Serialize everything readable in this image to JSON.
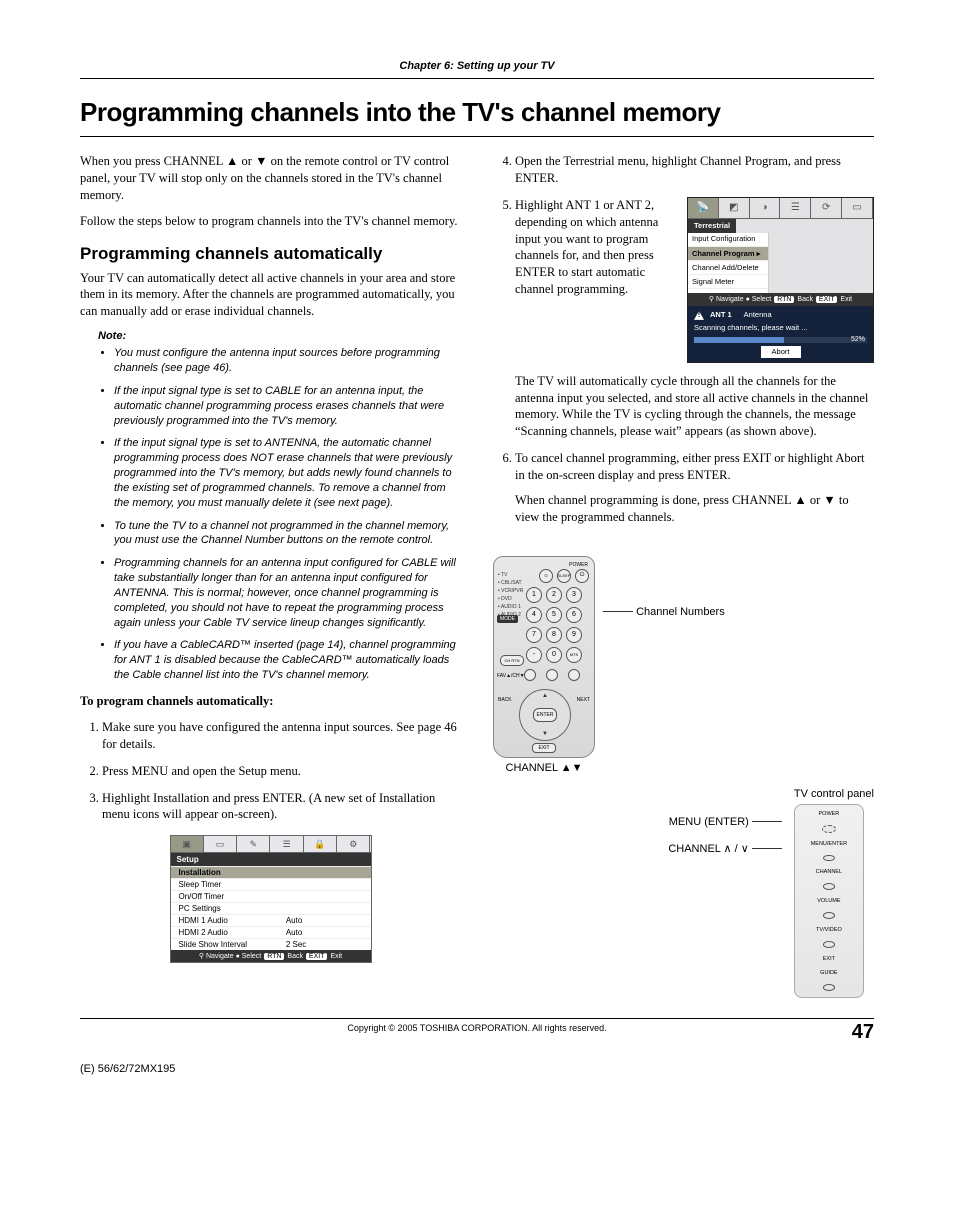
{
  "chapter_heading": "Chapter 6: Setting up your TV",
  "page_title": "Programming channels into the TV's channel memory",
  "intro_p1": "When you press CHANNEL ▲ or ▼ on the remote control or TV control panel, your TV will stop only on the channels stored in the TV's channel memory.",
  "intro_p2": "Follow the steps below to program channels into the TV's channel memory.",
  "section_heading": "Programming channels automatically",
  "section_p1": "Your TV can automatically detect all active channels in your area and store them in its memory. After the channels are programmed automatically, you can manually add or erase individual channels.",
  "note_title": "Note:",
  "notes": [
    "You must configure the antenna input sources before programming channels (see page 46).",
    "If the input signal type is set to CABLE for an antenna input, the automatic channel programming process erases channels that were previously programmed into the TV's memory.",
    "If the input signal type is set to ANTENNA, the automatic channel programming process does NOT erase channels that were previously programmed into the TV's memory, but adds newly found channels to the existing set of programmed channels. To remove a channel from the memory, you must manually delete it (see next page).",
    "To tune the TV to a channel not programmed in the channel memory, you must use the Channel Number buttons on the remote control.",
    "Programming channels for an antenna input configured for CABLE will take substantially longer than for an antenna input configured for ANTENNA. This is normal; however, once channel programming is completed, you should not have to repeat the programming process again unless your Cable TV service lineup changes significantly.",
    "If you have a CableCARD™ inserted (page 14), channel programming for ANT 1 is disabled because the CableCARD™ automatically loads the Cable channel list into the TV's channel memory."
  ],
  "proc_heading": "To program channels automatically:",
  "steps_left": [
    "Make sure you have configured the antenna input sources. See page 46 for details.",
    "Press MENU and open the Setup menu.",
    "Highlight Installation and press ENTER. (A new set of Installation menu icons will appear on-screen)."
  ],
  "steps_right": [
    "Open the Terrestrial menu, highlight Channel Program, and press ENTER.",
    "Highlight ANT 1 or ANT 2, depending on which antenna input you want to program channels for, and then press ENTER to start automatic channel programming.",
    "To cancel channel programming, either press EXIT or highlight Abort in the on-screen display and press ENTER."
  ],
  "post_step5_p": "The TV will automatically cycle through all the channels for the antenna input you selected, and store all active channels in the channel memory. While the TV is cycling through the channels, the message “Scanning channels, please wait” appears (as shown above).",
  "post_step6_p": "When channel programming is done, press CHANNEL ▲ or ▼ to view the programmed channels.",
  "setup_menu": {
    "title": "Setup",
    "rows": [
      {
        "label": "Installation",
        "value": "",
        "highlight": true
      },
      {
        "label": "Sleep Timer",
        "value": ""
      },
      {
        "label": "On/Off Timer",
        "value": ""
      },
      {
        "label": "PC Settings",
        "value": ""
      },
      {
        "label": "HDMI 1 Audio",
        "value": "Auto"
      },
      {
        "label": "HDMI 2 Audio",
        "value": "Auto"
      },
      {
        "label": "Slide Show Interval",
        "value": "2 Sec"
      }
    ],
    "footer": {
      "nav": "Navigate",
      "sel": "Select",
      "back": "Back",
      "exit": "Exit",
      "rtn": "RTN",
      "exitk": "EXIT"
    }
  },
  "terr_menu": {
    "title": "Terrestrial",
    "items": [
      {
        "label": "Input Configuration"
      },
      {
        "label": "Channel Program ▸",
        "highlight": true
      },
      {
        "label": "Channel Add/Delete"
      },
      {
        "label": "Signal Meter"
      }
    ]
  },
  "scan": {
    "ant": "ANT 1",
    "type": "Antenna",
    "msg": "Scanning channels, please wait ...",
    "pct": "52%",
    "abort": "Abort"
  },
  "remote": {
    "power": "POWER",
    "side_labels": "• TV\n• CBL/SAT\n• VCR/PVR\n• DVD\n• AUDIO 1\n• AUDIO 2",
    "mode": "MODE",
    "top2": "SLEEP",
    "numbers": [
      "1",
      "2",
      "3",
      "4",
      "5",
      "6",
      "7",
      "8",
      "9",
      "",
      "0",
      ""
    ],
    "fav": "FAV▲/CH▼",
    "chrtn": "CH RTN",
    "info": "INFO",
    "enter": "ENTER",
    "exit": "EXIT",
    "back": "BACK",
    "next": "NEXT",
    "callout1": "Channel Numbers",
    "channel_label": "CHANNEL ▲▼"
  },
  "tv_panel": {
    "title": "TV control panel",
    "label1": "MENU (ENTER)",
    "label2": "CHANNEL ∧ / ∨",
    "btn_power": "POWER",
    "btn_menu": "MENU/ENTER",
    "btn_channel": "CHANNEL",
    "btn_volume": "VOLUME",
    "btn_input": "TV/VIDEO",
    "btn_exit": "EXIT",
    "btn_guide": "GUIDE"
  },
  "copyright": "Copyright © 2005 TOSHIBA CORPORATION. All rights reserved.",
  "page_num": "47",
  "doc_code": "(E) 56/62/72MX195"
}
